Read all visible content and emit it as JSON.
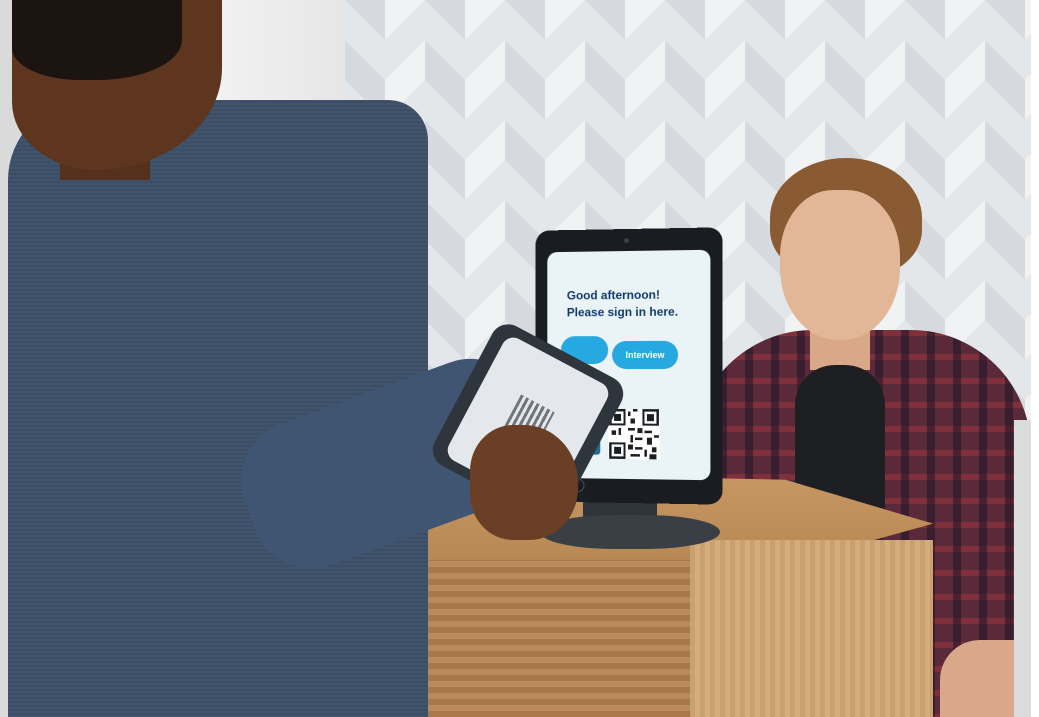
{
  "kiosk": {
    "greeting_line1": "Good afternoon!",
    "greeting_line2": "Please sign in here.",
    "buttons": [
      {
        "label": ""
      },
      {
        "label": "Interview"
      }
    ],
    "accent_color": "#26a8e0",
    "text_color": "#123a6b"
  },
  "icons": {
    "qr_code": "qr-code-icon",
    "phone_badge": "phone-icon"
  }
}
